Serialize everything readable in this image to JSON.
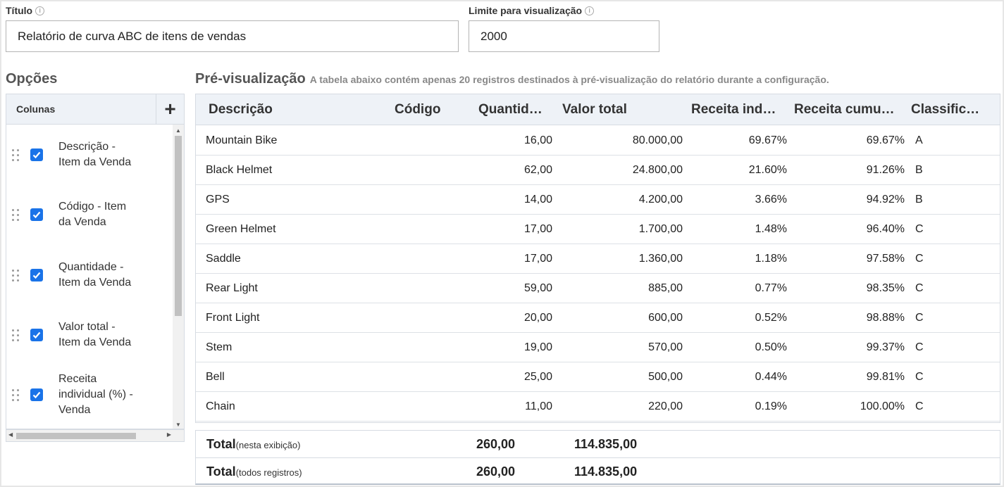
{
  "title_field": {
    "label": "Título",
    "value": "Relatório de curva ABC de itens de vendas"
  },
  "limit_field": {
    "label": "Limite para visualização",
    "value": "2000"
  },
  "options": {
    "title": "Opções",
    "columns_header": "Colunas",
    "add_icon": "plus-icon",
    "items": [
      {
        "label": "Descrição - Item da Venda",
        "checked": true
      },
      {
        "label": "Código - Item da Venda",
        "checked": true
      },
      {
        "label": "Quantidade - Item da Venda",
        "checked": true
      },
      {
        "label": "Valor total - Item da Venda",
        "checked": true
      },
      {
        "label": "Receita individual (%) - Venda",
        "checked": true
      }
    ]
  },
  "preview": {
    "title": "Pré-visualização",
    "note": "A tabela abaixo contém apenas 20 registros destinados à pré-visualização do relatório durante a configuração.",
    "columns": [
      "Descrição",
      "Código",
      "Quantid…",
      "Valor total",
      "Receita ind…",
      "Receita cumu…",
      "Classific…"
    ],
    "rows": [
      {
        "descricao": "Mountain Bike",
        "codigo": "",
        "quantidade": "16,00",
        "valor_total": "80.000,00",
        "receita_ind": "69.67%",
        "receita_cum": "69.67%",
        "classificacao": "A"
      },
      {
        "descricao": "Black Helmet",
        "codigo": "",
        "quantidade": "62,00",
        "valor_total": "24.800,00",
        "receita_ind": "21.60%",
        "receita_cum": "91.26%",
        "classificacao": "B"
      },
      {
        "descricao": "GPS",
        "codigo": "",
        "quantidade": "14,00",
        "valor_total": "4.200,00",
        "receita_ind": "3.66%",
        "receita_cum": "94.92%",
        "classificacao": "B"
      },
      {
        "descricao": "Green Helmet",
        "codigo": "",
        "quantidade": "17,00",
        "valor_total": "1.700,00",
        "receita_ind": "1.48%",
        "receita_cum": "96.40%",
        "classificacao": "C"
      },
      {
        "descricao": "Saddle",
        "codigo": "",
        "quantidade": "17,00",
        "valor_total": "1.360,00",
        "receita_ind": "1.18%",
        "receita_cum": "97.58%",
        "classificacao": "C"
      },
      {
        "descricao": "Rear Light",
        "codigo": "",
        "quantidade": "59,00",
        "valor_total": "885,00",
        "receita_ind": "0.77%",
        "receita_cum": "98.35%",
        "classificacao": "C"
      },
      {
        "descricao": "Front Light",
        "codigo": "",
        "quantidade": "20,00",
        "valor_total": "600,00",
        "receita_ind": "0.52%",
        "receita_cum": "98.88%",
        "classificacao": "C"
      },
      {
        "descricao": "Stem",
        "codigo": "",
        "quantidade": "19,00",
        "valor_total": "570,00",
        "receita_ind": "0.50%",
        "receita_cum": "99.37%",
        "classificacao": "C"
      },
      {
        "descricao": "Bell",
        "codigo": "",
        "quantidade": "25,00",
        "valor_total": "500,00",
        "receita_ind": "0.44%",
        "receita_cum": "99.81%",
        "classificacao": "C"
      },
      {
        "descricao": "Chain",
        "codigo": "",
        "quantidade": "11,00",
        "valor_total": "220,00",
        "receita_ind": "0.19%",
        "receita_cum": "100.00%",
        "classificacao": "C"
      }
    ],
    "totals": [
      {
        "label": "Total",
        "sublabel": "(nesta exibição)",
        "quantidade": "260,00",
        "valor_total": "114.835,00"
      },
      {
        "label": "Total",
        "sublabel": "(todos registros)",
        "quantidade": "260,00",
        "valor_total": "114.835,00"
      }
    ]
  },
  "colors": {
    "accent": "#1a73e8",
    "header_bg": "#eef2f7",
    "border": "#d6dbe2"
  }
}
